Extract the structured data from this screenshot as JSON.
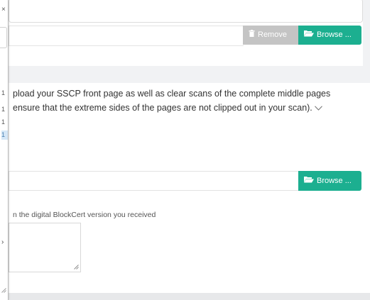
{
  "top_section": {
    "remove_label": "Remove",
    "browse_label": "Browse ..."
  },
  "main_section": {
    "instruction_line1": "pload your SSCP front page as well as clear scans of the complete middle pages",
    "instruction_line2": "ensure that the extreme sides of the pages are not clipped out in your scan).",
    "browse_label": "Browse ...",
    "blockcert_label": "n the digital BlockCert version you received"
  },
  "left_panel": {
    "close_glyph": "×",
    "rows": [
      "1",
      "1",
      "1",
      "1"
    ],
    "selected_index": 3,
    "arrow_glyph": "›"
  },
  "colors": {
    "accent_green": "#1caf90",
    "disabled_gray": "#c4c4c4",
    "page_bg": "#f1f2f4",
    "selection_blue": "#d5e7f7"
  },
  "icons": {
    "remove": "trash-icon",
    "browse": "folder-open-icon",
    "expand": "chevron-down-icon"
  }
}
